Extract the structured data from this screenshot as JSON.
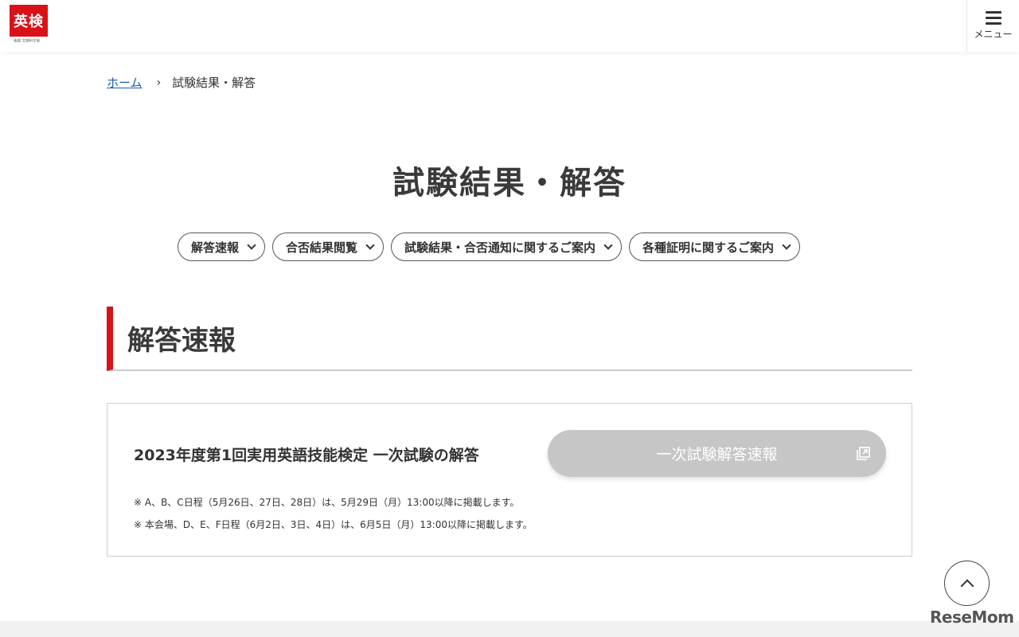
{
  "header": {
    "logo_text": "英検",
    "logo_sub": "後援 文部科学省",
    "menu_label": "メニュー"
  },
  "breadcrumb": {
    "home": "ホーム",
    "separator": "›",
    "current": "試験結果・解答"
  },
  "page_title": "試験結果・解答",
  "anchor_nav": [
    {
      "label": "解答速報"
    },
    {
      "label": "合否結果閲覧"
    },
    {
      "label": "試験結果・合否通知に関するご案内"
    },
    {
      "label": "各種証明に関するご案内"
    }
  ],
  "section": {
    "heading": "解答速報"
  },
  "card": {
    "title": "2023年度第1回実用英語技能検定 一次試験の解答",
    "button_label": "一次試験解答速報",
    "notes": [
      "※ A、B、C日程（5月26日、27日、28日）は、5月29日（月）13:00以降に掲載します。",
      "※ 本会場、D、E、F日程（6月2日、3日、4日）は、6月5日（月）13:00以降に掲載します。"
    ]
  },
  "watermark": "ReseMom",
  "colors": {
    "brand_red": "#d9121a",
    "button_disabled": "#c6c6c6",
    "link_blue": "#1a5fb4"
  }
}
